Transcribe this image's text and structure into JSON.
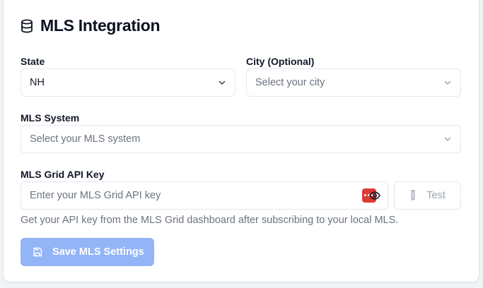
{
  "header": {
    "title": "MLS Integration",
    "icon": "database-icon"
  },
  "form": {
    "state": {
      "label": "State",
      "value": "NH"
    },
    "city": {
      "label": "City (Optional)",
      "placeholder": "Select your city"
    },
    "mls_system": {
      "label": "MLS System",
      "placeholder": "Select your MLS system"
    },
    "api_key": {
      "label": "MLS Grid API Key",
      "placeholder": "Enter your MLS Grid API key",
      "test_label": "Test",
      "help": "Get your API key from the MLS Grid dashboard after subscribing to your local MLS."
    }
  },
  "actions": {
    "save_label": "Save MLS Settings"
  },
  "colors": {
    "primary_disabled": "#93b4f7",
    "password_manager_badge": "#dc3a34",
    "border": "#e2e8f0"
  }
}
